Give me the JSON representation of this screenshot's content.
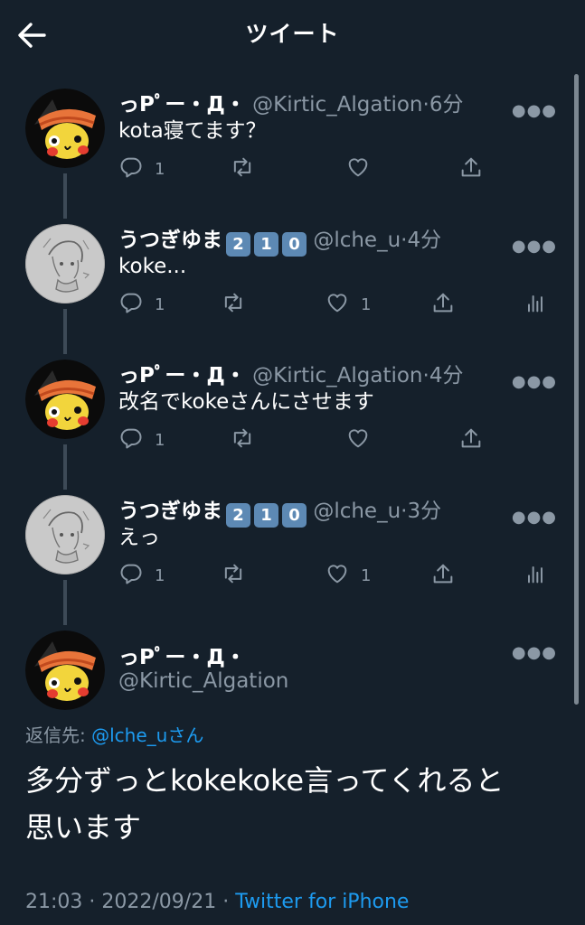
{
  "header": {
    "title": "ツイート"
  },
  "thread": [
    {
      "name": "っPﾟー・Д・",
      "badges": [],
      "handle": "@Kirtic_Algation",
      "sep": "·",
      "time": "6分",
      "text": "kota寝てます？",
      "reply_count": "1",
      "retweet_count": "",
      "like_count": "",
      "has_analytics": false,
      "avatar": "pikachu-avatar"
    },
    {
      "name": "うつぎゆま",
      "badges": [
        "2",
        "1",
        "0"
      ],
      "handle": "@lche_u",
      "sep": "·",
      "time": "4分",
      "text": "koke...",
      "reply_count": "1",
      "retweet_count": "",
      "like_count": "1",
      "has_analytics": true,
      "avatar": "sketch-avatar"
    },
    {
      "name": "っPﾟー・Д・",
      "badges": [],
      "handle": "@Kirtic_Algation",
      "sep": "·",
      "time": "4分",
      "text": "改名でkokeさんにさせます",
      "reply_count": "1",
      "retweet_count": "",
      "like_count": "",
      "has_analytics": false,
      "avatar": "pikachu-avatar"
    },
    {
      "name": "うつぎゆま",
      "badges": [
        "2",
        "1",
        "0"
      ],
      "handle": "@lche_u",
      "sep": "·",
      "time": "3分",
      "text": "えっ",
      "reply_count": "1",
      "retweet_count": "",
      "like_count": "1",
      "has_analytics": true,
      "avatar": "sketch-avatar"
    }
  ],
  "main_tweet": {
    "name": "っPﾟー・Д・",
    "handle": "@Kirtic_Algation",
    "reply_prefix": "返信先: ",
    "reply_handle": "@lche_u",
    "reply_suffix": "さん",
    "text_line1": "多分ずっとkokekoke言ってくれると",
    "text_line2": "思います",
    "time": "21:03",
    "date": "2022/09/21",
    "sep": "·",
    "source": "Twitter for iPhone"
  },
  "colors": {
    "background": "#15202b",
    "secondary_text": "#8b98a5",
    "link": "#1d9bf0",
    "badge": "#5d89b4"
  }
}
